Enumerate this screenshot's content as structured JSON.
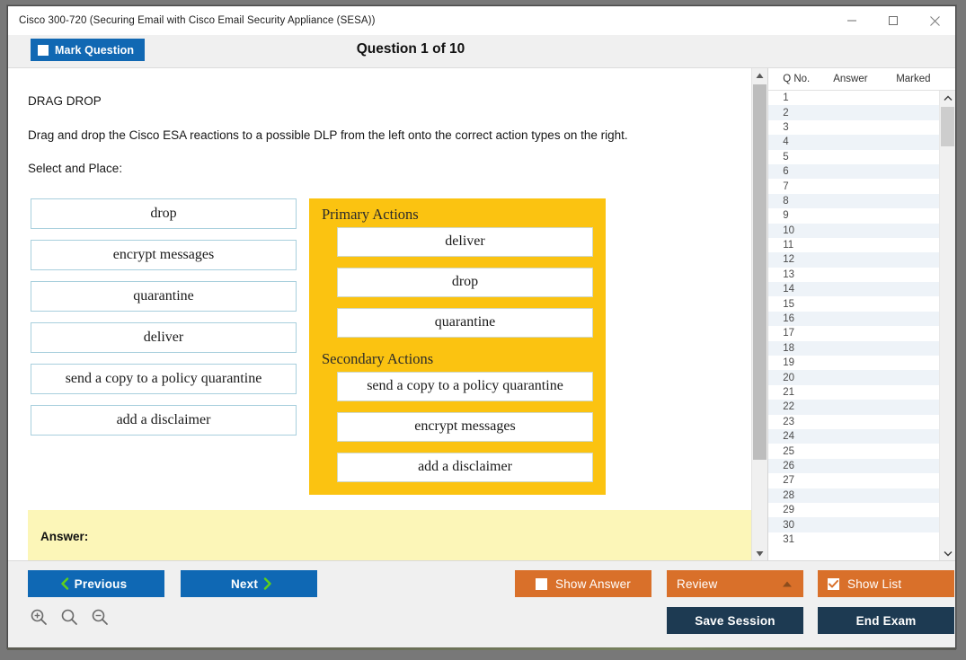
{
  "window": {
    "title": "Cisco 300-720 (Securing Email with Cisco Email Security Appliance (SESA))",
    "minimize_label": "minimize-icon",
    "maximize_label": "maximize-icon",
    "close_label": "close-icon"
  },
  "header": {
    "mark_question_label": "Mark Question",
    "mark_question_checked": false,
    "question_heading": "Question 1 of 10"
  },
  "question": {
    "type_label": "DRAG DROP",
    "prompt": "Drag and drop the Cisco ESA reactions to a possible DLP from the left onto the correct action types on the right.",
    "instruction": "Select and Place:",
    "source_items": [
      "drop",
      "encrypt messages",
      "quarantine",
      "deliver",
      "send a copy to a policy quarantine",
      "add a disclaimer"
    ],
    "target_groups": [
      {
        "label": "Primary Actions",
        "items": [
          "deliver",
          "drop",
          "quarantine"
        ]
      },
      {
        "label": "Secondary Actions",
        "items": [
          "send a copy to a policy quarantine",
          "encrypt messages",
          "add a disclaimer"
        ]
      }
    ],
    "answer_label": "Answer:",
    "answer_value": ""
  },
  "question_list": {
    "columns": [
      "Q No.",
      "Answer",
      "Marked"
    ],
    "rows": [
      {
        "no": "1",
        "answer": "",
        "marked": ""
      },
      {
        "no": "2",
        "answer": "",
        "marked": ""
      },
      {
        "no": "3",
        "answer": "",
        "marked": ""
      },
      {
        "no": "4",
        "answer": "",
        "marked": ""
      },
      {
        "no": "5",
        "answer": "",
        "marked": ""
      },
      {
        "no": "6",
        "answer": "",
        "marked": ""
      },
      {
        "no": "7",
        "answer": "",
        "marked": ""
      },
      {
        "no": "8",
        "answer": "",
        "marked": ""
      },
      {
        "no": "9",
        "answer": "",
        "marked": ""
      },
      {
        "no": "10",
        "answer": "",
        "marked": ""
      },
      {
        "no": "11",
        "answer": "",
        "marked": ""
      },
      {
        "no": "12",
        "answer": "",
        "marked": ""
      },
      {
        "no": "13",
        "answer": "",
        "marked": ""
      },
      {
        "no": "14",
        "answer": "",
        "marked": ""
      },
      {
        "no": "15",
        "answer": "",
        "marked": ""
      },
      {
        "no": "16",
        "answer": "",
        "marked": ""
      },
      {
        "no": "17",
        "answer": "",
        "marked": ""
      },
      {
        "no": "18",
        "answer": "",
        "marked": ""
      },
      {
        "no": "19",
        "answer": "",
        "marked": ""
      },
      {
        "no": "20",
        "answer": "",
        "marked": ""
      },
      {
        "no": "21",
        "answer": "",
        "marked": ""
      },
      {
        "no": "22",
        "answer": "",
        "marked": ""
      },
      {
        "no": "23",
        "answer": "",
        "marked": ""
      },
      {
        "no": "24",
        "answer": "",
        "marked": ""
      },
      {
        "no": "25",
        "answer": "",
        "marked": ""
      },
      {
        "no": "26",
        "answer": "",
        "marked": ""
      },
      {
        "no": "27",
        "answer": "",
        "marked": ""
      },
      {
        "no": "28",
        "answer": "",
        "marked": ""
      },
      {
        "no": "29",
        "answer": "",
        "marked": ""
      },
      {
        "no": "30",
        "answer": "",
        "marked": ""
      },
      {
        "no": "31",
        "answer": "",
        "marked": ""
      }
    ]
  },
  "footer": {
    "previous_label": "Previous",
    "next_label": "Next",
    "show_answer_label": "Show Answer",
    "show_answer_checked": false,
    "review_label": "Review",
    "show_list_label": "Show List",
    "show_list_checked": true,
    "save_session_label": "Save Session",
    "end_exam_label": "End Exam",
    "zoom_in_label": "zoom-in-icon",
    "zoom_reset_label": "zoom-reset-icon",
    "zoom_out_label": "zoom-out-icon"
  },
  "colors": {
    "accent_blue": "#0f68b4",
    "accent_orange": "#d9702a",
    "accent_navy": "#1d3a52",
    "panel_yellow": "#fbc311",
    "answer_yellow": "#fcf6b8",
    "item_border_blue": "#a8cfdd"
  }
}
